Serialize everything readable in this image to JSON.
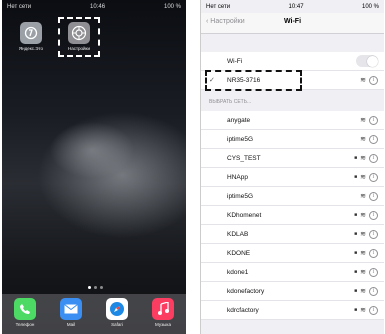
{
  "left": {
    "status": {
      "carrier": "Нет сети",
      "time": "10:46",
      "battery": "100 %"
    },
    "apps": [
      {
        "label": "Яндекс.Это",
        "icon": "yandex-app-icon"
      },
      {
        "label": "Настройки",
        "icon": "settings-gear-icon"
      }
    ],
    "dock": [
      {
        "label": "Телефон",
        "icon": "phone-icon",
        "color": "#4cd964"
      },
      {
        "label": "Mail",
        "icon": "mail-icon",
        "color": "#3b8ff3"
      },
      {
        "label": "Safari",
        "icon": "compass-icon",
        "color": "#1e88e5"
      },
      {
        "label": "Музыка",
        "icon": "music-note-icon",
        "color": "#fb3d61"
      }
    ]
  },
  "right": {
    "status": {
      "carrier": "Нет сети",
      "time": "10:47",
      "battery": "100 %"
    },
    "nav": {
      "back": "Настройки",
      "title": "Wi-Fi"
    },
    "wifi_label": "Wi-Fi",
    "connected": "NR35-3716",
    "section_header": "ВЫБРАТЬ СЕТЬ...",
    "networks": [
      {
        "name": "anygate",
        "locked": false
      },
      {
        "name": "iptime5G",
        "locked": false
      },
      {
        "name": "CYS_TEST",
        "locked": true
      },
      {
        "name": "HNApp",
        "locked": true
      },
      {
        "name": "iptime5G",
        "locked": false
      },
      {
        "name": "KDhomenet",
        "locked": true
      },
      {
        "name": "KDLAB",
        "locked": true
      },
      {
        "name": "KDONE",
        "locked": true
      },
      {
        "name": "kdone1",
        "locked": true
      },
      {
        "name": "kdonefactory",
        "locked": true
      },
      {
        "name": "kdrcfactory",
        "locked": true
      }
    ]
  }
}
